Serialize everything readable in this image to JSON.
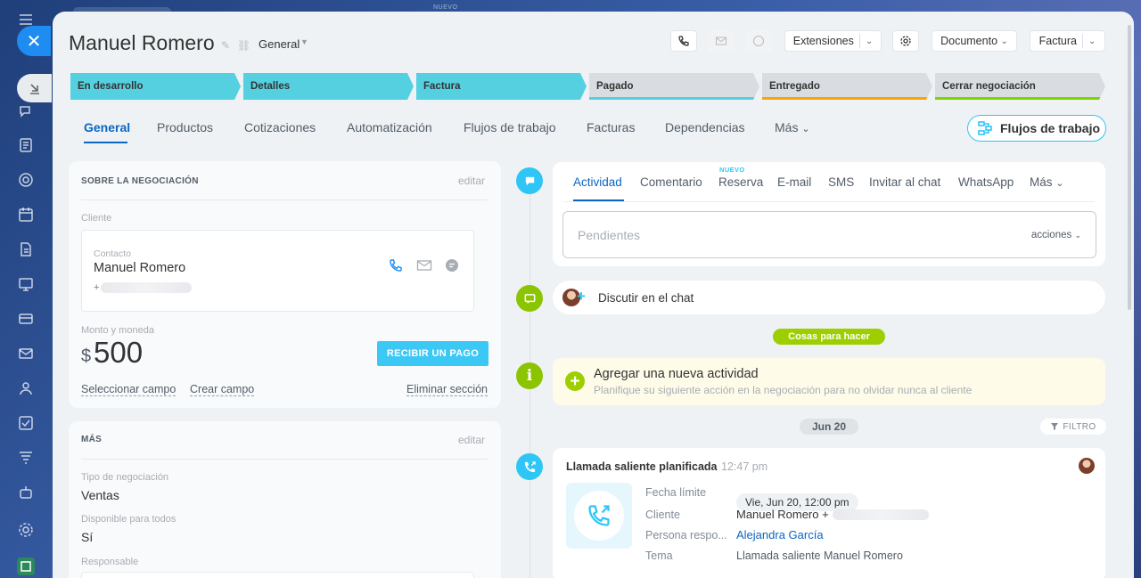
{
  "header": {
    "title": "Manuel Romero",
    "category": "General",
    "buttons": {
      "extensions": "Extensiones",
      "document": "Documento",
      "invoice": "Factura"
    }
  },
  "top_label": "NUEVO",
  "stages": [
    {
      "label": "En desarrollo",
      "color": "#55d0e0"
    },
    {
      "label": "Detalles",
      "color": "#55d0e0"
    },
    {
      "label": "Factura",
      "color": "#55d0e0"
    },
    {
      "label": "Pagado",
      "color": "#55d0e0"
    },
    {
      "label": "Entregado",
      "color": "#f7a700"
    },
    {
      "label": "Cerrar negociación",
      "color": "#7bd500"
    }
  ],
  "tabs": [
    "General",
    "Productos",
    "Cotizaciones",
    "Automatización",
    "Flujos de trabajo",
    "Facturas",
    "Dependencias",
    "Más"
  ],
  "workflows_button": "Flujos de trabajo",
  "about": {
    "heading": "SOBRE LA NEGOCIACIÓN",
    "edit": "editar",
    "client_label": "Cliente",
    "contact_label": "Contacto",
    "contact_name": "Manuel Romero",
    "phone_prefix": "+",
    "amount_label": "Monto y moneda",
    "currency_symbol": "$",
    "amount": "500",
    "pay_button": "RECIBIR UN PAGO",
    "select_field": "Seleccionar campo",
    "create_field": "Crear campo",
    "delete_section": "Eliminar sección"
  },
  "more": {
    "heading": "MÁS",
    "edit": "editar",
    "deal_type_label": "Tipo de negociación",
    "deal_type": "Ventas",
    "available_label": "Disponible para todos",
    "available": "Sí",
    "responsible_label": "Responsable"
  },
  "activity": {
    "tabs": [
      "Actividad",
      "Comentario",
      "Reserva",
      "E-mail",
      "SMS",
      "Invitar al chat",
      "WhatsApp",
      "Más"
    ],
    "new_badge": "NUEVO",
    "pending_placeholder": "Pendientes",
    "actions": "acciones"
  },
  "chat": {
    "label": "Discutir en el chat"
  },
  "todo_chip": "Cosas para hacer",
  "todo": {
    "title": "Agregar una nueva actividad",
    "subtitle": "Planifique su siguiente acción en la negociación para no olvidar nunca al cliente"
  },
  "date_chip": "Jun 20",
  "filter": "FILTRO",
  "call": {
    "title": "Llamada saliente planificada",
    "time": "12:47 pm",
    "deadline_label": "Fecha límite",
    "deadline": "Vie, Jun 20, 12:00 pm",
    "client_label": "Cliente",
    "client": "Manuel Romero +",
    "responsible_label": "Persona respo...",
    "responsible": "Alejandra García",
    "subject_label": "Tema",
    "subject": "Llamada saliente Manuel Romero"
  }
}
